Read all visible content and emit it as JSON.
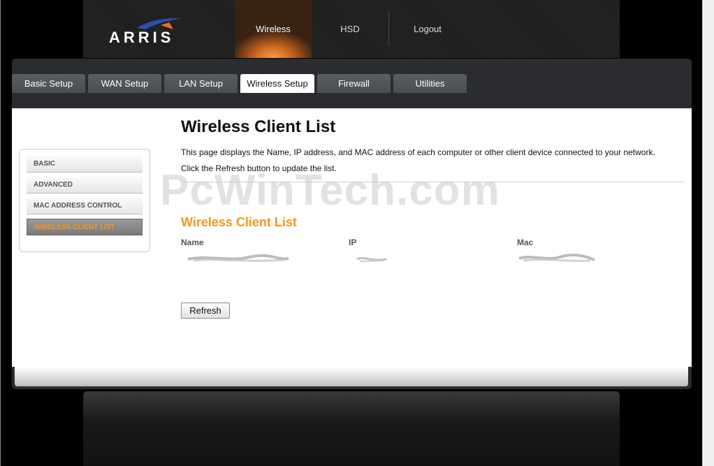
{
  "brand": {
    "logo_text": "ARRIS"
  },
  "top_nav": [
    {
      "label": "Wireless",
      "active": true
    },
    {
      "label": "HSD",
      "active": false
    },
    {
      "label": "Logout",
      "active": false
    }
  ],
  "tabs": [
    {
      "label": "Basic Setup",
      "active": false
    },
    {
      "label": "WAN Setup",
      "active": false
    },
    {
      "label": "LAN Setup",
      "active": false
    },
    {
      "label": "Wireless Setup",
      "active": true
    },
    {
      "label": "Firewall",
      "active": false
    },
    {
      "label": "Utilities",
      "active": false
    }
  ],
  "sidebar": {
    "items": [
      {
        "label": "BASIC",
        "active": false
      },
      {
        "label": "ADVANCED",
        "active": false
      },
      {
        "label": "MAC ADDRESS CONTROL",
        "active": false
      },
      {
        "label": "WIRELESS CLIENT LIST",
        "active": true
      }
    ]
  },
  "page": {
    "title": "Wireless Client List",
    "description_line1": "This page displays the Name, IP address, and MAC address of each computer or other client device connected to your network.",
    "description_line2": "Click the Refresh button to update the list.",
    "watermark": "PcWinTech.com",
    "section_title": "Wireless Client List",
    "table": {
      "columns": [
        "Name",
        "IP",
        "Mac"
      ]
    },
    "refresh_label": "Refresh"
  },
  "colors": {
    "accent": "#f7941e",
    "panel": "#2a2c30",
    "tab": "#4a4d52"
  }
}
